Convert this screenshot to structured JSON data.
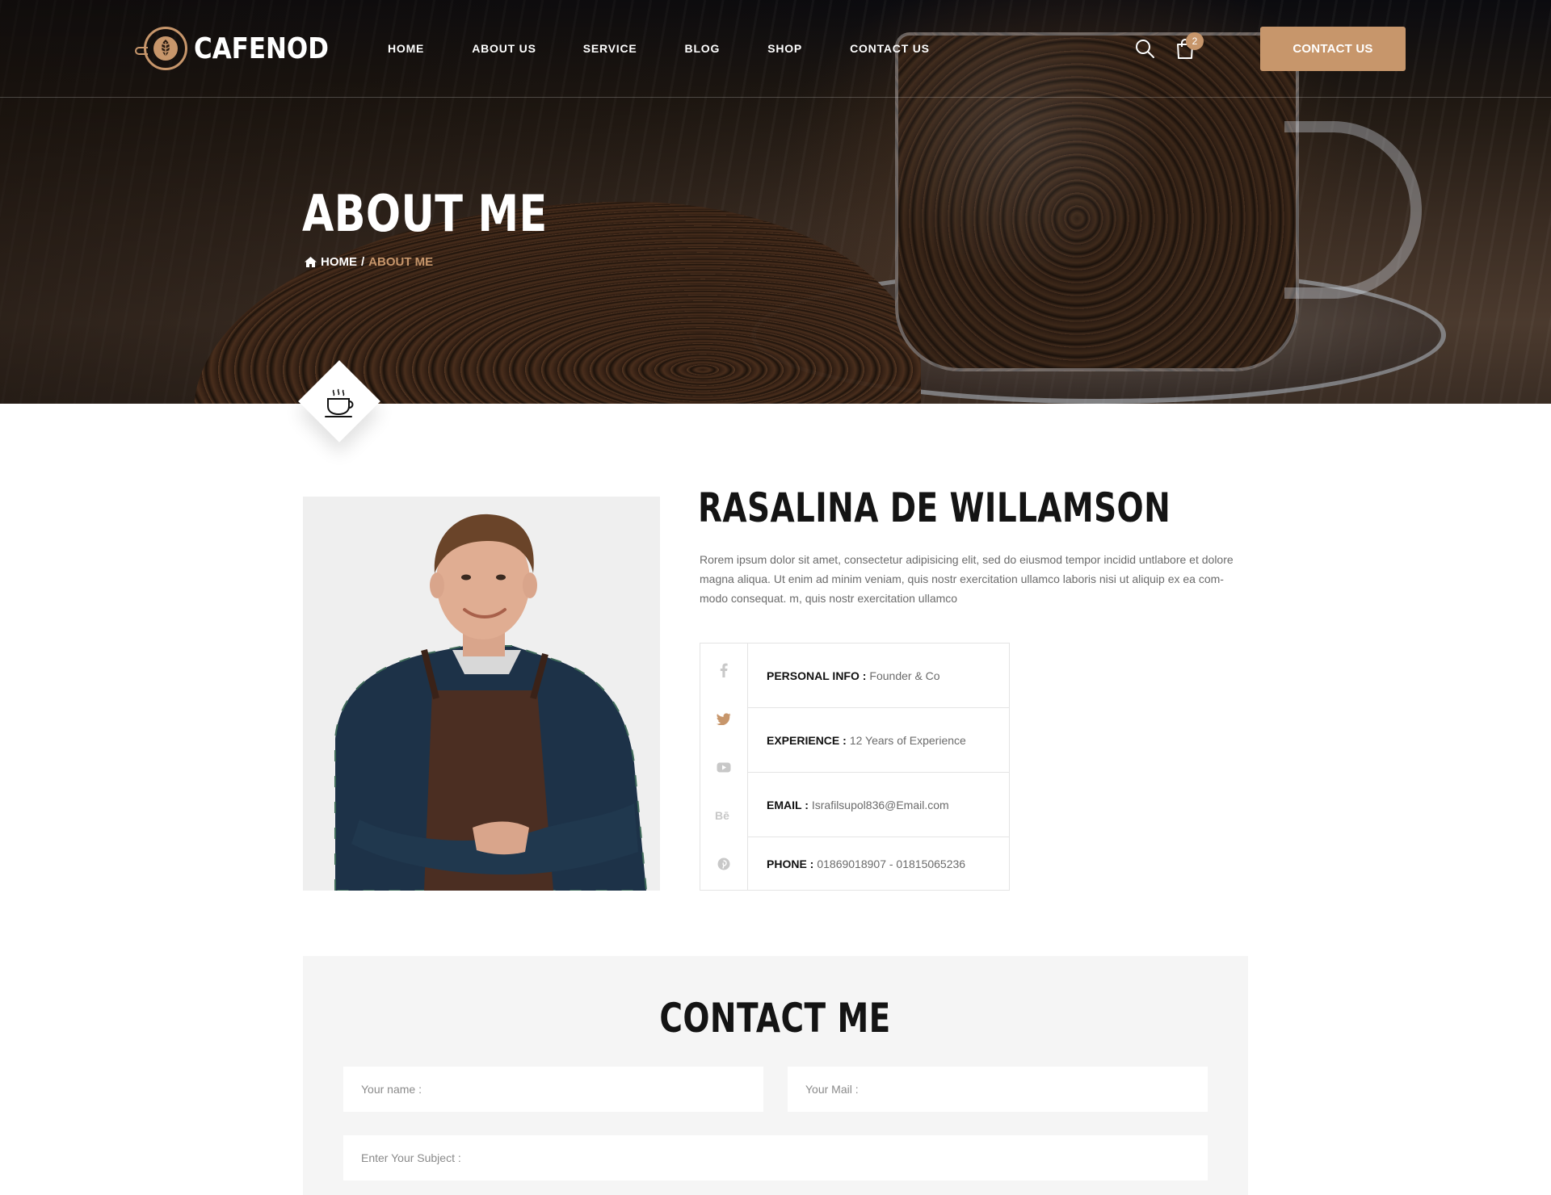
{
  "brand": {
    "name": "CAFENOD"
  },
  "nav": {
    "items": [
      "HOME",
      "ABOUT US",
      "SERVICE",
      "BLOG",
      "SHOP",
      "CONTACT US"
    ]
  },
  "header": {
    "cart_count": "2",
    "cta_label": "CONTACT US"
  },
  "hero": {
    "title": "ABOUT ME",
    "breadcrumb": {
      "home": "HOME",
      "separator": "/",
      "current": "ABOUT ME"
    }
  },
  "profile": {
    "name": "RASALINA DE WILLAMSON",
    "bio": "Rorem ipsum dolor sit amet, consectetur adipisicing elit, sed do eiusmod tempor incidid untlabore et dolore magna aliqua. Ut enim ad minim veniam, quis nostr exercitation ullamco laboris nisi ut aliquip ex ea com-modo consequat. m, quis nostr exercitation ullamco",
    "social": [
      "facebook-icon",
      "twitter-icon",
      "youtube-icon",
      "behance-icon",
      "pinterest-icon"
    ],
    "info": [
      {
        "label": "PERSONAL INFO :",
        "value": "Founder & Co"
      },
      {
        "label": "EXPERIENCE :",
        "value": "12 Years of Experience"
      },
      {
        "label": "EMAIL :",
        "value": "Israfilsupol836@Email.com"
      },
      {
        "label": "PHONE :",
        "value": "01869018907 - 01815065236"
      }
    ]
  },
  "contact": {
    "title": "CONTACT ME",
    "name_placeholder": "Your name :",
    "mail_placeholder": "Your Mail :",
    "subject_placeholder": "Enter Your Subject :"
  },
  "colors": {
    "accent": "#c7966b",
    "dark": "#141414",
    "text_muted": "#6b6b6b",
    "panel": "#f5f5f5"
  }
}
